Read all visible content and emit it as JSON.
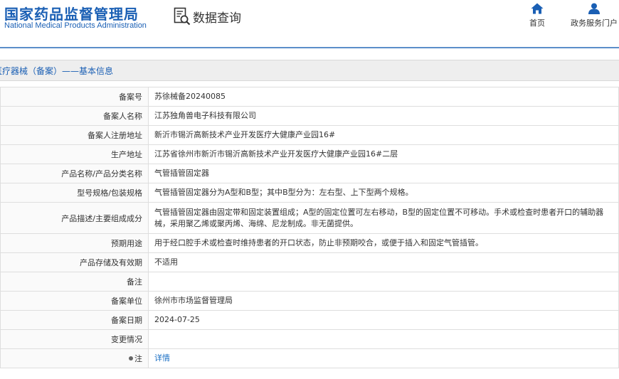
{
  "header": {
    "logo_cn": "国家药品监督管理局",
    "logo_en": "National Medical Products Administration",
    "query_title": "数据查询",
    "nav": [
      {
        "label": "首页",
        "icon": "home-icon"
      },
      {
        "label": "政务服务门户",
        "icon": "user-icon"
      }
    ]
  },
  "section_title": "医疗器械（备案）——基本信息",
  "fields": [
    {
      "label": "备案号",
      "value": "苏徐械备20240085"
    },
    {
      "label": "备案人名称",
      "value": "江苏独角兽电子科技有限公司"
    },
    {
      "label": "备案人注册地址",
      "value": "新沂市锡沂高新技术产业开发医疗大健康产业园16#"
    },
    {
      "label": "生产地址",
      "value": "江苏省徐州市新沂市锡沂高新技术产业开发医疗大健康产业园16#二层"
    },
    {
      "label": "产品名称/产品分类名称",
      "value": "气管插管固定器"
    },
    {
      "label": "型号规格/包装规格",
      "value": "气管插管固定器分为A型和B型；其中B型分为：左右型、上下型两个规格。"
    },
    {
      "label": "产品描述/主要组成成分",
      "value": "气管插管固定器由固定带和固定装置组成；A型的固定位置可左右移动，B型的固定位置不可移动。手术或检查时患者开口的辅助器械，采用聚乙烯或聚丙烯、海绵、尼龙制成。非无菌提供。"
    },
    {
      "label": "预期用途",
      "value": "用于经口腔手术或检查时维持患者的开口状态，防止非预期咬合，或便于插入和固定气管插管。"
    },
    {
      "label": "产品存储及有效期",
      "value": "不适用"
    },
    {
      "label": "备注",
      "value": ""
    },
    {
      "label": "备案单位",
      "value": "徐州市市场监督管理局"
    },
    {
      "label": "备案日期",
      "value": "2024-07-25"
    },
    {
      "label": "变更情况",
      "value": ""
    },
    {
      "label": "注",
      "value": "详情"
    }
  ]
}
